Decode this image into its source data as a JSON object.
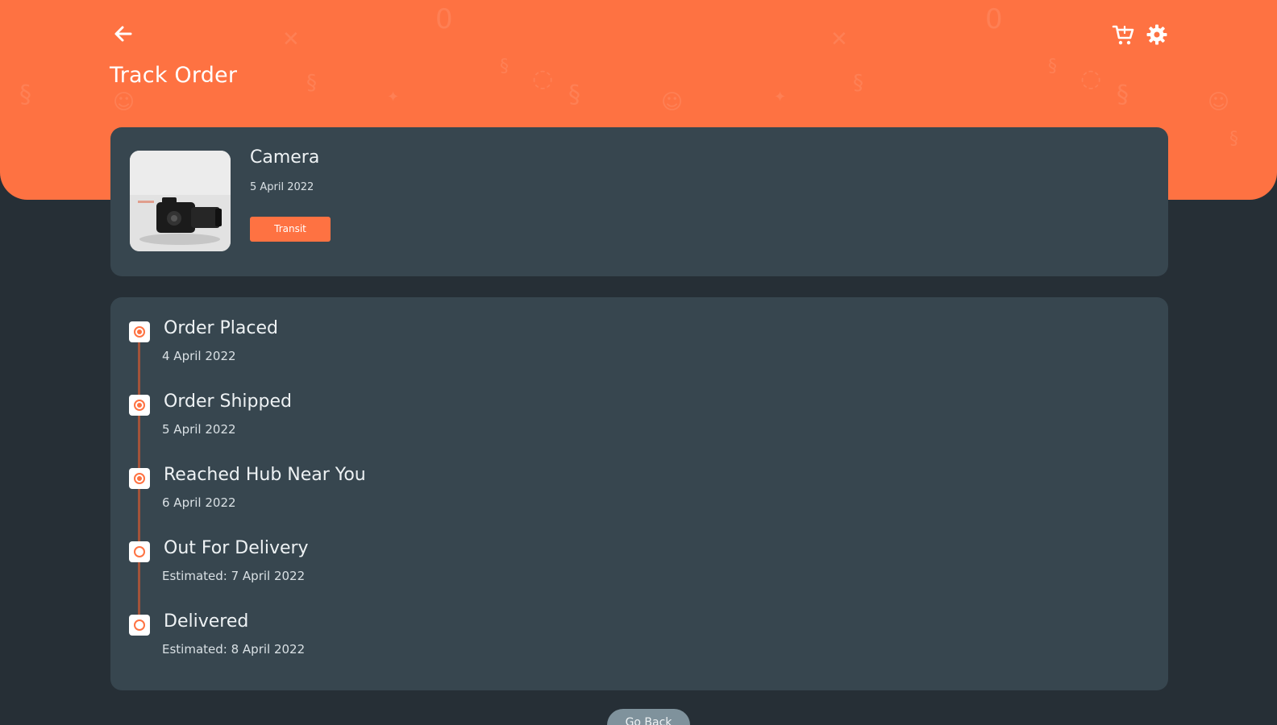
{
  "header": {
    "title": "Track Order",
    "back_icon": "arrow-left-icon",
    "cart_icon": "shopping-cart-icon",
    "settings_icon": "gear-icon",
    "accent_color": "#fe7242"
  },
  "product": {
    "name": "Camera",
    "date": "5 April 2022",
    "status": "Transit",
    "image": "camera-photo"
  },
  "timeline": {
    "steps": [
      {
        "title": "Order Placed",
        "date": "4 April 2022",
        "completed": true
      },
      {
        "title": "Order Shipped",
        "date": "5 April 2022",
        "completed": true
      },
      {
        "title": "Reached Hub Near You",
        "date": "6 April 2022",
        "completed": true
      },
      {
        "title": "Out For Delivery",
        "date": "Estimated: 7 April 2022",
        "completed": false
      },
      {
        "title": "Delivered",
        "date": "Estimated: 8 April 2022",
        "completed": false
      }
    ]
  },
  "footer": {
    "go_back_label": "Go Back"
  }
}
